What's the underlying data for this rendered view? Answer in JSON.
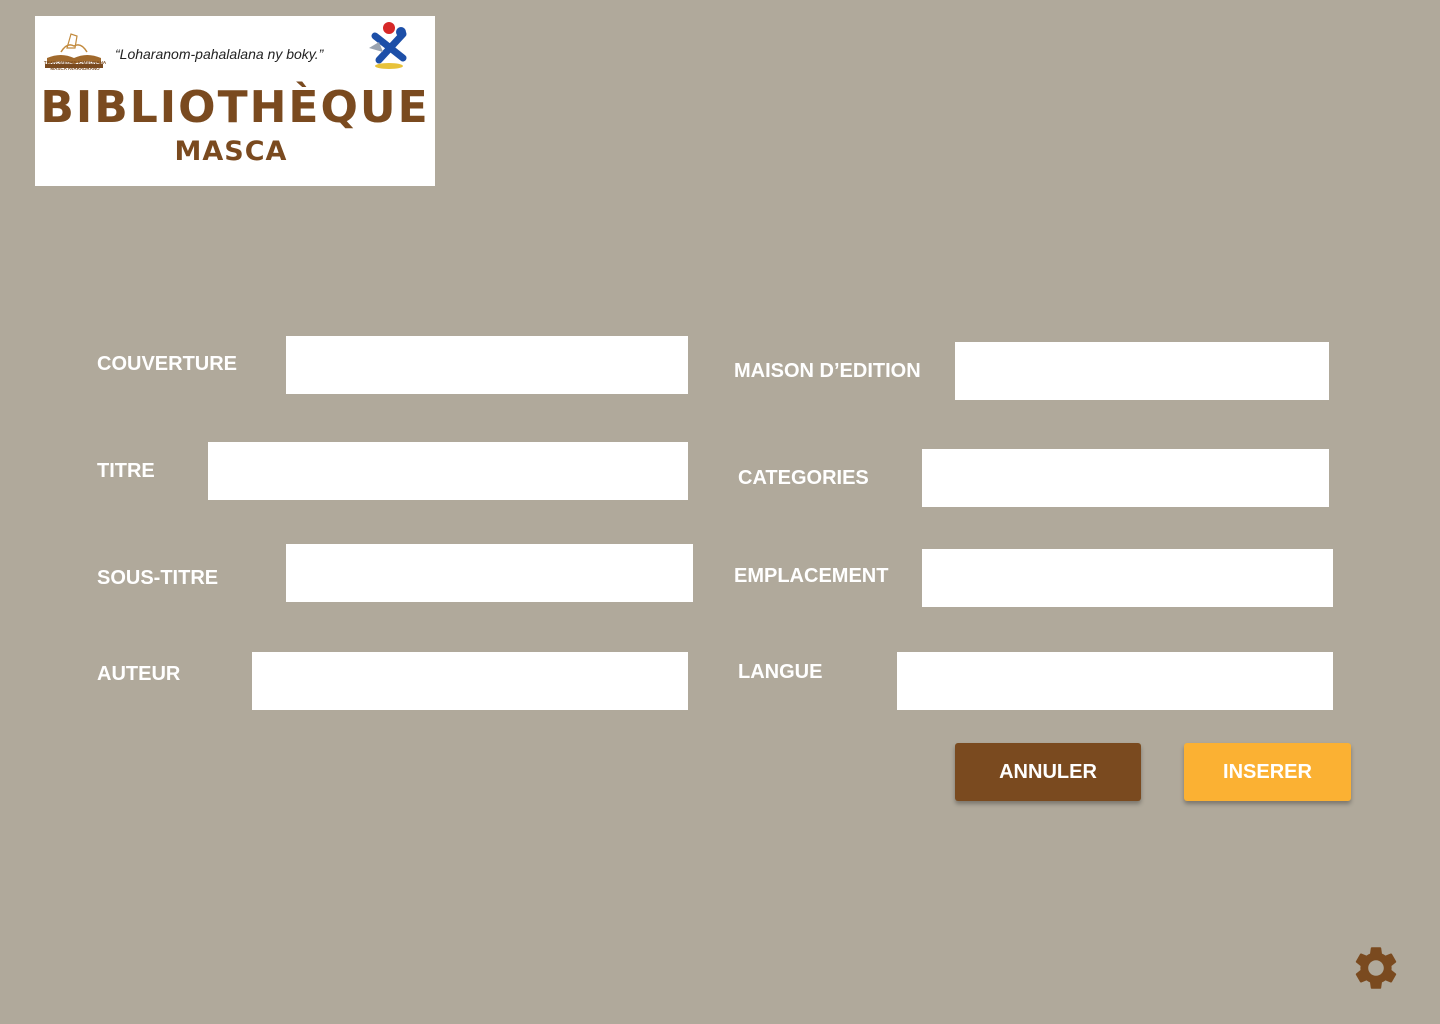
{
  "logo": {
    "book_caption": "TRANOMBOKY IOMBONANA MASCA AVARADRANO",
    "slogan": "“Loharanom-pahalalana ny boky.”",
    "title": "BIBLIOTHÈQUE",
    "subtitle": "MASCA",
    "brand_color": "#7a4a1f"
  },
  "form": {
    "left": [
      {
        "label": "COUVERTURE",
        "value": "",
        "placeholder": ""
      },
      {
        "label": "TITRE",
        "value": "",
        "placeholder": ""
      },
      {
        "label": "SOUS-TITRE",
        "value": "",
        "placeholder": ""
      },
      {
        "label": "AUTEUR",
        "value": "",
        "placeholder": ""
      }
    ],
    "right": [
      {
        "label": "MAISON D’EDITION",
        "value": "",
        "placeholder": ""
      },
      {
        "label": "CATEGORIES",
        "value": "",
        "placeholder": ""
      },
      {
        "label": "EMPLACEMENT",
        "value": "",
        "placeholder": ""
      },
      {
        "label": "LANGUE",
        "value": "",
        "placeholder": ""
      }
    ]
  },
  "actions": {
    "cancel_label": "ANNULER",
    "insert_label": "INSERER",
    "cancel_color": "#7a4a1f",
    "insert_color": "#fbb133"
  },
  "settings": {
    "icon": "gear-icon",
    "color": "#7a4a1f"
  },
  "background_color": "#b0a99b"
}
